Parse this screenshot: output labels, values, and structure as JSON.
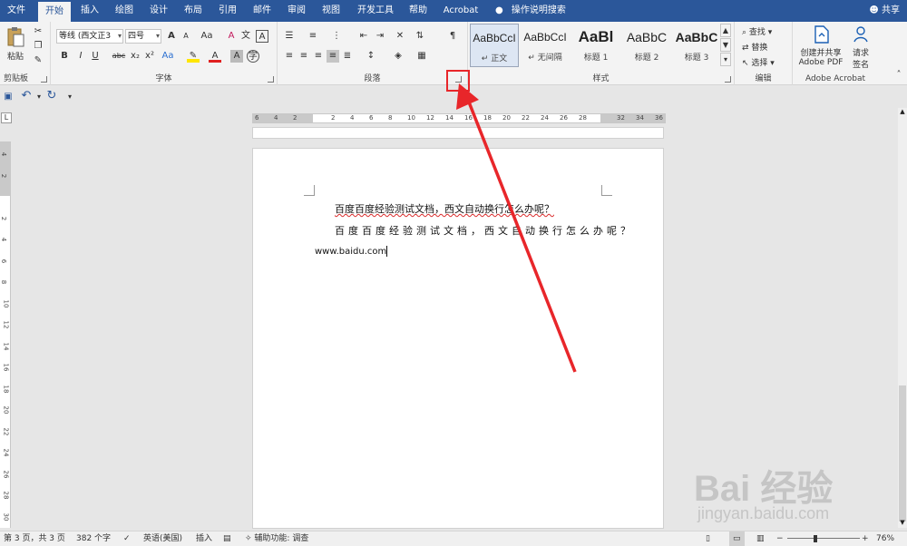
{
  "tabs": [
    {
      "label": "文件"
    },
    {
      "label": "开始"
    },
    {
      "label": "插入"
    },
    {
      "label": "绘图"
    },
    {
      "label": "设计"
    },
    {
      "label": "布局"
    },
    {
      "label": "引用"
    },
    {
      "label": "邮件"
    },
    {
      "label": "审阅"
    },
    {
      "label": "视图"
    },
    {
      "label": "开发工具"
    },
    {
      "label": "帮助"
    },
    {
      "label": "Acrobat"
    }
  ],
  "tell_me": "操作说明搜索",
  "share": "共享",
  "ribbon": {
    "clipboard": {
      "paste": "粘贴",
      "label": "剪贴板"
    },
    "font": {
      "font_name": "等线 (西文正3",
      "font_size": "四号",
      "label": "字体",
      "bold": "B",
      "italic": "I",
      "underline": "U",
      "strike": "abc",
      "sub": "x₂",
      "sup": "x²",
      "grow": "A",
      "shrink": "A",
      "case": "Aa",
      "clear": "A",
      "box": "A",
      "color": "A",
      "shade": "A",
      "wen": "文"
    },
    "paragraph": {
      "label": "段落"
    },
    "styles": {
      "label": "样式",
      "items": [
        {
          "sample": "AaBbCcI",
          "name": "↵ 正文"
        },
        {
          "sample": "AaBbCcI",
          "name": "↵ 无间隔"
        },
        {
          "sample": "AaBl",
          "name": "标题 1"
        },
        {
          "sample": "AaBbC",
          "name": "标题 2"
        },
        {
          "sample": "AaBbC",
          "name": "标题 3"
        }
      ]
    },
    "editing": {
      "find": "查找",
      "replace": "替换",
      "select": "选择",
      "label": "编辑"
    },
    "acrobat": {
      "create_line1": "创建并共享",
      "create_line2": "Adobe PDF",
      "sign_line1": "请求",
      "sign_line2": "签名",
      "label": "Adobe Acrobat"
    }
  },
  "ruler_h": [
    "6",
    "4",
    "2",
    "",
    "2",
    "4",
    "6",
    "8",
    "10",
    "12",
    "14",
    "16",
    "18",
    "20",
    "22",
    "24",
    "26",
    "28",
    "",
    "32",
    "34",
    "36"
  ],
  "ruler_v": [
    "4",
    "2",
    "",
    "2",
    "4",
    "6",
    "8",
    "10",
    "12",
    "14",
    "16",
    "18",
    "20",
    "22",
    "24",
    "26",
    "28",
    "30"
  ],
  "document": {
    "line1": "百度百度经验测试文档，西文自动换行怎么办呢？",
    "line2": "百度百度经验测试文档，西文自动换行怎么办呢？",
    "line3": "www.baidu.com"
  },
  "status": {
    "page": "第 3 页，共 3 页",
    "words": "382 个字",
    "lang": "英语(美国)",
    "mode": "插入",
    "access": "辅助功能: 调查",
    "zoom": "76%"
  },
  "watermark": {
    "big": "Bai 经验",
    "small": "jingyan.baidu.com"
  },
  "colors": {
    "accent": "#2b579a",
    "highlight": "#e8262a"
  }
}
